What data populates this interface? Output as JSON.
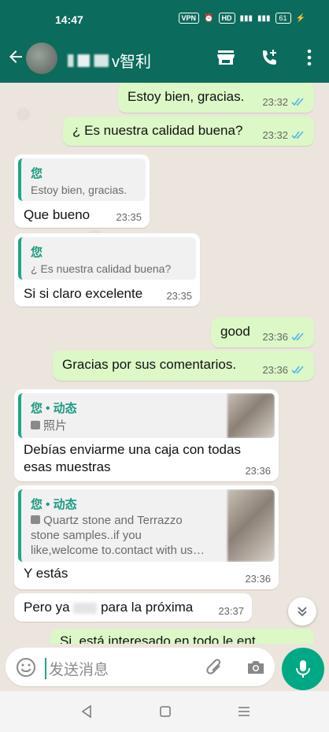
{
  "status_bar": {
    "time": "14:47",
    "vpn": "VPN",
    "hd": "HD",
    "battery": "61"
  },
  "header": {
    "contact_name": "v智利",
    "colors": {
      "bar": "#0b6b5c",
      "accent": "#1ea58a"
    }
  },
  "messages": [
    {
      "type": "out",
      "text": "Estoy bien, gracias.",
      "time": "23:32"
    },
    {
      "type": "out",
      "text": "¿ Es nuestra calidad buena?",
      "time": "23:32"
    },
    {
      "type": "in",
      "quote_author": "您",
      "quote_text": "Estoy bien, gracias.",
      "text": "Que bueno",
      "time": "23:35"
    },
    {
      "type": "in",
      "quote_author": "您",
      "quote_text": "¿ Es nuestra calidad buena?",
      "text": "Si si claro excelente",
      "time": "23:35"
    },
    {
      "type": "out",
      "text": "good",
      "time": "23:36"
    },
    {
      "type": "out",
      "text": "Gracias por sus comentarios.",
      "time": "23:36"
    },
    {
      "type": "in",
      "quote_author": "您 • 动态",
      "quote_text": "照片",
      "text_line1": "Debías enviarme una caja con todas",
      "text_line2": "esas muestras",
      "time": "23:36"
    },
    {
      "type": "in",
      "quote_author": "您 • 动态",
      "quote_line1": "Quartz stone and Terrazzo",
      "quote_line2": "stone samples..if you",
      "quote_line3": "like,welcome to.contact with us…",
      "text": "Y estás",
      "time": "23:36"
    },
    {
      "type": "in",
      "text_a": "Pero ya",
      "text_b": "para la próxima",
      "time": "23:37"
    },
    {
      "type": "out",
      "text": "Si, está interesado en todo le ent",
      "time": ""
    }
  ],
  "composer": {
    "placeholder": "发送消息"
  }
}
